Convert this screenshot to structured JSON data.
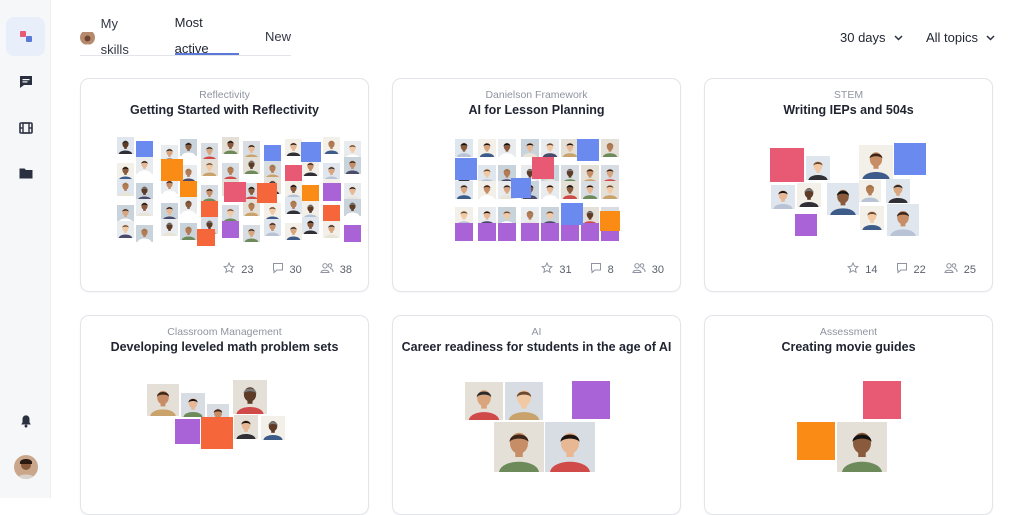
{
  "tabs": [
    {
      "label": "My skills",
      "active": false
    },
    {
      "label": "Most active",
      "active": true
    },
    {
      "label": "New",
      "active": false
    }
  ],
  "filters": {
    "period": "30 days",
    "topics": "All topics"
  },
  "sidebar": {
    "items": [
      "home-icon",
      "chat-icon",
      "film-icon",
      "folder-icon"
    ],
    "bottom": [
      "bell-icon",
      "user-avatar"
    ]
  },
  "colors": {
    "blue": "#6b8af0",
    "pink": "#e85a73",
    "orange": "#fa8c16",
    "red_orange": "#f5663b",
    "purple": "#a963d6",
    "accent": "#5b79d9"
  },
  "cards": [
    {
      "category": "Reflectivity",
      "title": "Getting Started with Reflectivity",
      "stars": "23",
      "comments": "30",
      "people": "38"
    },
    {
      "category": "Danielson Framework",
      "title": "AI for Lesson Planning",
      "stars": "31",
      "comments": "8",
      "people": "30"
    },
    {
      "category": "STEM",
      "title": "Writing IEPs and 504s",
      "stars": "14",
      "comments": "22",
      "people": "25"
    },
    {
      "category": "Classroom Management",
      "title": "Developing leveled math problem sets"
    },
    {
      "category": "AI",
      "title": "Career readiness for students in the age of AI"
    },
    {
      "category": "Assessment",
      "title": "Creating movie guides"
    }
  ]
}
